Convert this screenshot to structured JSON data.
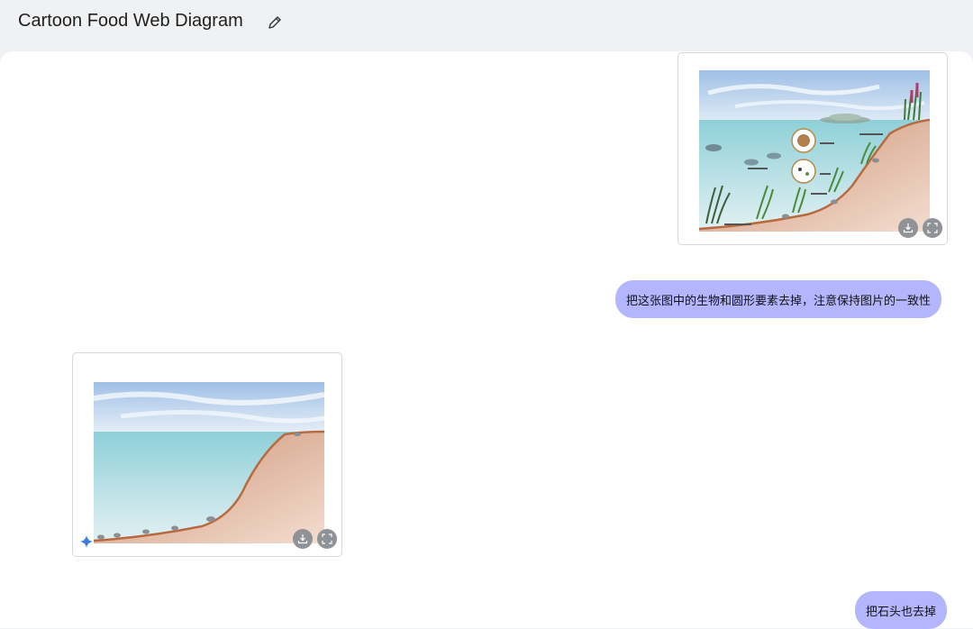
{
  "header": {
    "title": "Cartoon Food Web Diagram"
  },
  "icons": {
    "edit": "pencil-icon",
    "download": "download-icon",
    "fullscreen": "fullscreen-icon",
    "assistant": "sparkle-icon"
  },
  "messages": {
    "user_1": "把这张图中的生物和圆形要素去掉，注意保持图片的一致性",
    "user_2": "把石头也去掉"
  },
  "colors": {
    "bubble": "#b3b6ff",
    "sky": "#aecbea",
    "water": "#7ec8d3",
    "sand": "#dcae92",
    "soil_line": "#b86a3f",
    "button": "#8f9296"
  }
}
